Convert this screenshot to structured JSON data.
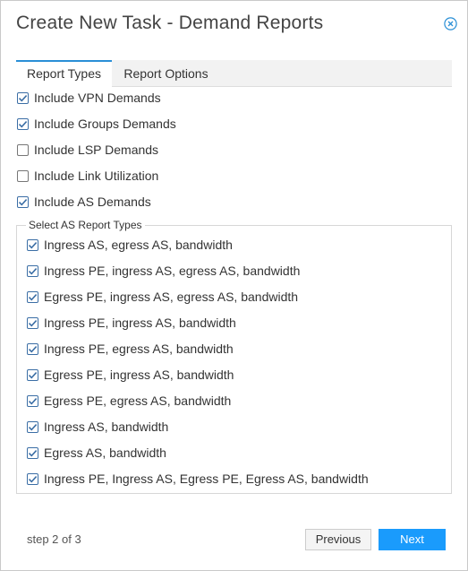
{
  "dialog": {
    "title": "Create New Task - Demand Reports",
    "close_icon": "close-circle-icon"
  },
  "tabs": [
    {
      "label": "Report Types",
      "active": true
    },
    {
      "label": "Report Options",
      "active": false
    }
  ],
  "options": [
    {
      "label": "Include VPN Demands",
      "checked": true
    },
    {
      "label": "Include Groups Demands",
      "checked": true
    },
    {
      "label": "Include LSP Demands",
      "checked": false
    },
    {
      "label": "Include Link Utilization",
      "checked": false
    },
    {
      "label": "Include AS Demands",
      "checked": true
    }
  ],
  "as_report_types": {
    "legend": "Select AS Report Types",
    "items": [
      {
        "label": "Ingress AS, egress AS, bandwidth",
        "checked": true
      },
      {
        "label": "Ingress PE, ingress AS, egress AS, bandwidth",
        "checked": true
      },
      {
        "label": "Egress PE, ingress AS, egress AS, bandwidth",
        "checked": true
      },
      {
        "label": "Ingress PE, ingress AS, bandwidth",
        "checked": true
      },
      {
        "label": "Ingress PE, egress AS, bandwidth",
        "checked": true
      },
      {
        "label": "Egress PE, ingress AS, bandwidth",
        "checked": true
      },
      {
        "label": "Egress PE, egress AS, bandwidth",
        "checked": true
      },
      {
        "label": "Ingress AS, bandwidth",
        "checked": true
      },
      {
        "label": "Egress AS, bandwidth",
        "checked": true
      },
      {
        "label": "Ingress PE, Ingress AS, Egress PE, Egress AS, bandwidth",
        "checked": true
      }
    ]
  },
  "footer": {
    "step_text": "step 2 of 3",
    "previous_label": "Previous",
    "next_label": "Next"
  },
  "colors": {
    "accent": "#1a9bfc",
    "tab_indicator": "#2a8fd6",
    "check_mark": "#3b6ea5"
  }
}
